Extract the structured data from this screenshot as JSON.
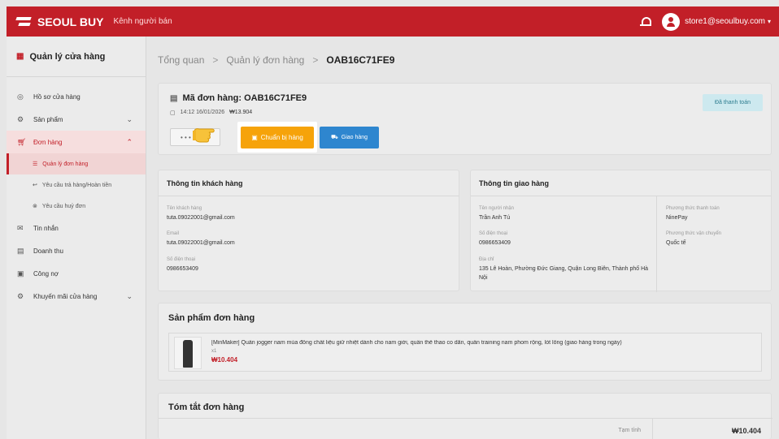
{
  "topbar": {
    "brand": "SEOUL BUY",
    "subtitle": "Kênh người bán",
    "account_email": "store1@seoulbuy.com",
    "accent_color": "#c21f28"
  },
  "sidebar": {
    "title": "Quản lý cửa hàng",
    "items": [
      {
        "label": "Hồ sơ cửa hàng",
        "icon": "store-icon"
      },
      {
        "label": "Sản phẩm",
        "icon": "box-icon"
      },
      {
        "label": "Đơn hàng",
        "icon": "cart-icon"
      },
      {
        "label": "Tin nhắn",
        "icon": "chat-icon"
      },
      {
        "label": "Doanh thu",
        "icon": "chart-icon"
      },
      {
        "label": "Công nợ",
        "icon": "debt-icon"
      },
      {
        "label": "Khuyến mãi cửa hàng",
        "icon": "promo-icon"
      }
    ],
    "order_subitems": [
      {
        "label": "Quản lý đơn hàng",
        "icon": "list-icon"
      },
      {
        "label": "Yêu cầu trả hàng/Hoàn tiền",
        "icon": "return-icon"
      },
      {
        "label": "Yêu cầu huỷ đơn",
        "icon": "cancel-icon"
      }
    ]
  },
  "breadcrumb": {
    "items": [
      "Tổng quan",
      "Quản lý đơn hàng"
    ],
    "separator": ">",
    "current": "OAB16C71FE9"
  },
  "order": {
    "title": "Mã đơn hàng: OAB16C71FE9",
    "datetime": "14:12 16/01/2026",
    "amount": "₩13.904",
    "status_badge": "Đã thanh toán",
    "more_button": "• • •",
    "prepare_button": "Chuẩn bị hàng",
    "ship_button": "Giao hàng"
  },
  "customer": {
    "heading": "Thông tin khách hàng",
    "name_label": "Tên khách hàng",
    "name": "tuta.09022001@gmail.com",
    "email_label": "Email",
    "email": "tuta.09022001@gmail.com",
    "phone_label": "Số điện thoại",
    "phone": "0986653409"
  },
  "shipping": {
    "heading": "Thông tin giao hàng",
    "receiver_label": "Tên người nhận",
    "receiver": "Trần Anh Tú",
    "phone_label": "Số điện thoại",
    "phone": "0986653409",
    "address_label": "Địa chỉ",
    "address": "135 Lê Hoàn, Phường Đức Giang, Quận Long Biên, Thành phố Hà Nội",
    "payment_label": "Phương thức thanh toán",
    "payment": "NinePay",
    "shipping_method_label": "Phương thức vận chuyển",
    "shipping_method": "Quốc tế"
  },
  "products": {
    "heading": "Sản phẩm đơn hàng",
    "items": [
      {
        "name": "[MinMaker] Quần jogger nam mùa đông chất liệu giữ nhiệt dành cho nam giới, quần thể thao co dãn, quần training nam phom rộng, lót lông (giao hàng trong ngày)",
        "qty": "x1",
        "price": "₩10.404"
      }
    ]
  },
  "summary": {
    "heading": "Tóm tắt đơn hàng",
    "subtotal_label": "Tạm tính",
    "subtotal": "₩10.404"
  }
}
